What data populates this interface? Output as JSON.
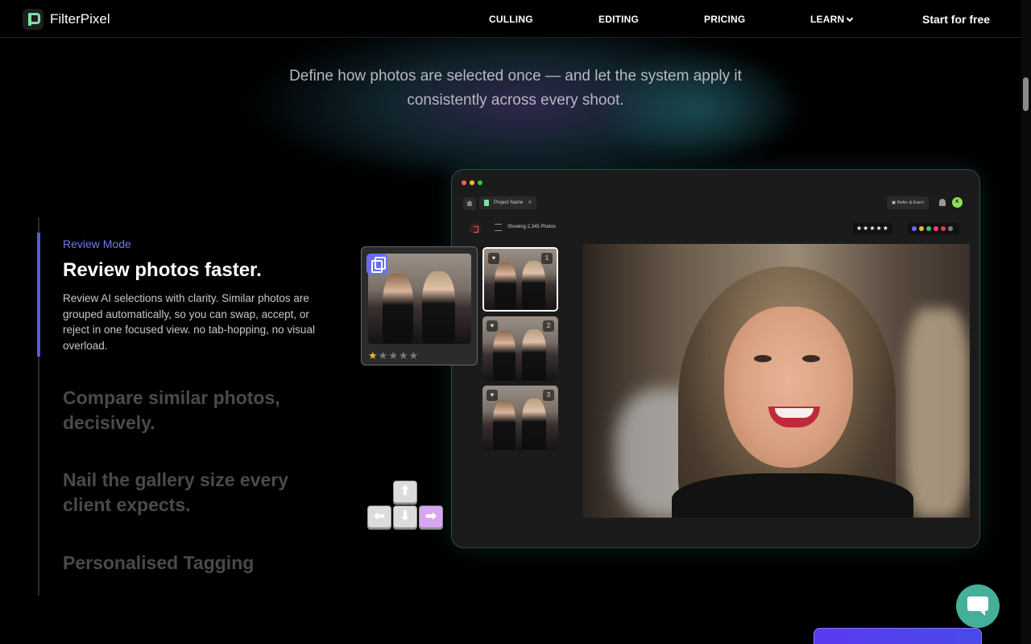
{
  "nav": {
    "brand": "FilterPixel",
    "links": [
      "CULLING",
      "EDITING",
      "PRICING",
      "LEARN"
    ],
    "cta": "Start for free"
  },
  "hero": {
    "subtitle": "Define how photos are selected once — and let the system apply it consistently across every shoot."
  },
  "features": {
    "active": {
      "eyebrow": "Review Mode",
      "title": "Review photos faster.",
      "description": "Review AI selections with clarity. Similar photos are grouped automatically, so you can swap, accept, or reject in one focused view. no tab-hopping, no visual overload."
    },
    "others": [
      "Compare similar photos, decisively.",
      "Nail the gallery size every client expects.",
      "Personalised Tagging"
    ]
  },
  "mockup": {
    "project_tab": "Project Name",
    "refer_button": "Refer & Earn!",
    "avatar_initial": "K",
    "showing_text": "Showing 2,345 Photos",
    "rating_filter": "★★★★★",
    "thumbnail_numbers": [
      "1",
      "2",
      "3"
    ],
    "color_labels": [
      "#6b6ff0",
      "#f0b43a",
      "#3cc65a",
      "#f03a8a",
      "#e04040",
      "#7a7a7a"
    ],
    "traffic_lights": [
      "#ff5f57",
      "#febc2e",
      "#28c840"
    ],
    "floating_card_rating": 1,
    "floating_card_rating_max": 5
  },
  "keys": {
    "up": "⬆",
    "left": "⬅",
    "down": "⬇",
    "right": "➡"
  },
  "colors": {
    "accent": "#4f5ce8",
    "eyebrow": "#6b7bf0",
    "chat": "#45b09a"
  }
}
